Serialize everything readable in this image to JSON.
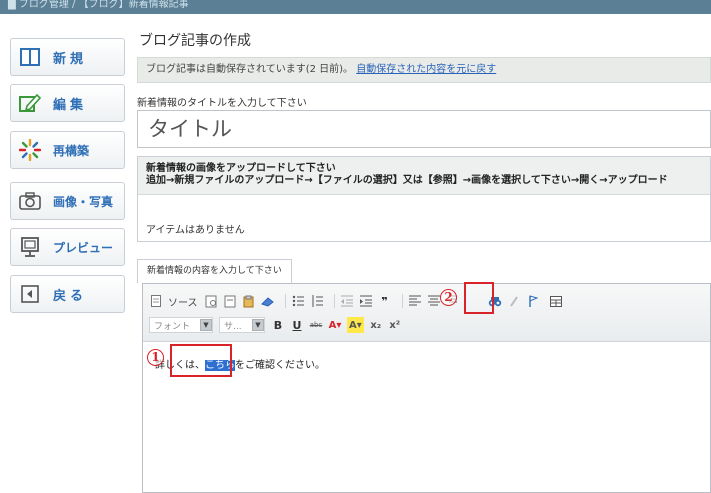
{
  "topbar": {
    "crumb": "▇ ブログ管理 / 【ブログ】新着情報記事"
  },
  "sidebar": {
    "items": [
      {
        "label": "新規",
        "icon": "new-icon"
      },
      {
        "label": "編集",
        "icon": "edit-icon"
      },
      {
        "label": "再構築",
        "icon": "rebuild-icon"
      },
      {
        "label": "画像・写真",
        "icon": "camera-icon"
      },
      {
        "label": "プレビュー",
        "icon": "preview-icon"
      },
      {
        "label": "戻る",
        "icon": "back-icon"
      }
    ]
  },
  "main": {
    "title": "ブログ記事の作成",
    "autosave_text": "ブログ記事は自動保存されています(2 日前)。",
    "autosave_link": "自動保存された内容を元に戻す",
    "title_label": "新着情報のタイトルを入力して下さい",
    "title_value": "タイトル",
    "upload": {
      "heading": "新着情報の画像をアップロードして下さい",
      "instructions": "追加→新規ファイルのアップロード→【ファイルの選択】又は【参照】→画像を選択して下さい→開く→アップロード",
      "empty": "アイテムはありません"
    },
    "content_tab": "新着情報の内容を入力して下さい"
  },
  "editor": {
    "source_label": "ソース",
    "font_combo": "フォント",
    "size_combo": "サ...",
    "content_prefix": "詳しくは、",
    "content_selected": "こちら",
    "content_suffix": "をご確認ください。"
  },
  "annotations": {
    "marker1": "1",
    "marker2": "2"
  },
  "colors": {
    "accent": "#2f6fb6",
    "highlight": "#d9232b",
    "selection": "#2f6fd1"
  }
}
